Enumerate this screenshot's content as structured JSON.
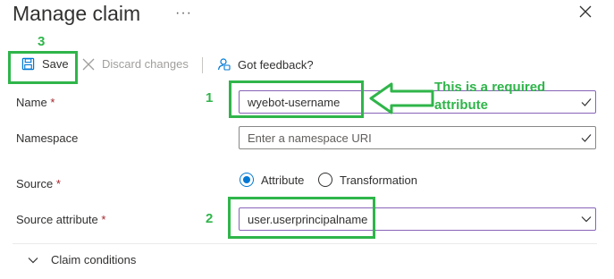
{
  "header": {
    "title": "Manage claim",
    "more_label": "···"
  },
  "toolbar": {
    "save_label": "Save",
    "discard_label": "Discard changes",
    "feedback_label": "Got feedback?"
  },
  "form": {
    "required_mark": "*",
    "name": {
      "label": "Name",
      "value": "wyebot-username"
    },
    "namespace": {
      "label": "Namespace",
      "placeholder": "Enter a namespace URI"
    },
    "source": {
      "label": "Source",
      "options": [
        "Attribute",
        "Transformation"
      ],
      "selected": "Attribute"
    },
    "source_attribute": {
      "label": "Source attribute",
      "value": "user.userprincipalname"
    },
    "claim_conditions_label": "Claim conditions"
  },
  "annotations": {
    "num_save": "3",
    "num_name": "1",
    "num_source_attr": "2",
    "note_line1": "This is a required",
    "note_line2": "attribute",
    "color": "#2fb54a"
  },
  "colors": {
    "accent": "#0078d4",
    "required": "#a4262c",
    "focus_border": "#8764b8"
  }
}
